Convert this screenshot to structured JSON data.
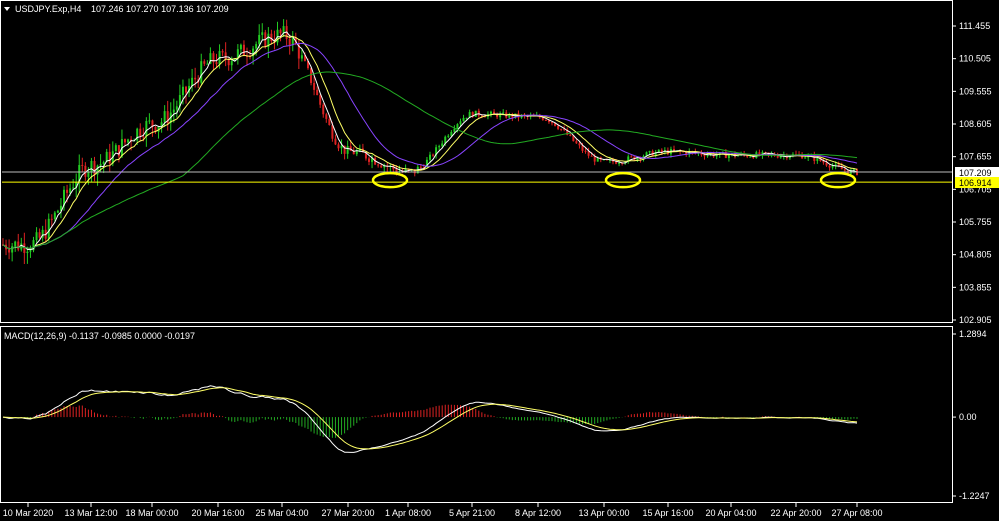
{
  "colors": {
    "background": "#000000",
    "grid": "#ffffff",
    "bull_candle": "#22cc22",
    "bear_candle": "#dd2222",
    "ma_fast": "#ffffff",
    "ma_mid": "#ffff66",
    "ma_slow": "#8844ff",
    "ma_long": "#22aa22",
    "level_line": "#ffff00",
    "highlight_circle": "#ffff00",
    "macd_line": "#ffffff",
    "signal_line": "#ffff66",
    "hist_pos": "#dd2222",
    "hist_neg": "#22aa22",
    "price_tag_current": "#ffffff",
    "price_tag_level": "#ffff00"
  },
  "header": {
    "symbol": "USDJPY.Exp,H4",
    "ohlc": "107.246 107.270 107.136 107.209"
  },
  "macd_header": {
    "label": "MACD(12,26,9) -0.1137 -0.0985 0.0000 -0.0197"
  },
  "price_axis": {
    "ticks": [
      "111.455",
      "110.505",
      "109.555",
      "108.605",
      "107.655",
      "106.705",
      "105.755",
      "104.805",
      "103.855",
      "102.905"
    ],
    "current_price_tag": "107.209",
    "level_price_tag": "106.914"
  },
  "macd_axis": {
    "ticks": [
      "1.2894",
      "0.00",
      "-1.2247"
    ]
  },
  "time_axis": {
    "ticks": [
      "10 Mar 2020",
      "13 Mar 12:00",
      "18 Mar 00:00",
      "20 Mar 16:00",
      "25 Mar 04:00",
      "27 Mar 20:00",
      "1 Apr 08:00",
      "5 Apr 21:00",
      "8 Apr 12:00",
      "13 Apr 00:00",
      "15 Apr 16:00",
      "20 Apr 04:00",
      "22 Apr 20:00",
      "27 Apr 08:00"
    ]
  },
  "chart_data": {
    "type": "line",
    "symbol": "USDJPY",
    "timeframe": "H4",
    "ylim": [
      102.905,
      111.455
    ],
    "x_tick_labels": [
      "10 Mar 2020",
      "13 Mar 12:00",
      "18 Mar 00:00",
      "20 Mar 16:00",
      "25 Mar 04:00",
      "27 Mar 20:00",
      "1 Apr 08:00",
      "5 Apr 21:00",
      "8 Apr 12:00",
      "13 Apr 00:00",
      "15 Apr 16:00",
      "20 Apr 04:00",
      "22 Apr 20:00",
      "27 Apr 08:00"
    ],
    "close_path": [
      {
        "x": "10 Mar 2020",
        "y": 105.1
      },
      {
        "x": "13 Mar 12:00",
        "y": 107.4
      },
      {
        "x": "18 Mar 00:00",
        "y": 108.6
      },
      {
        "x": "20 Mar 16:00",
        "y": 110.5
      },
      {
        "x": "25 Mar 04:00",
        "y": 111.2
      },
      {
        "x": "27 Mar 20:00",
        "y": 107.8
      },
      {
        "x": "1 Apr 08:00",
        "y": 107.2
      },
      {
        "x": "5 Apr 21:00",
        "y": 108.9
      },
      {
        "x": "8 Apr 12:00",
        "y": 108.8
      },
      {
        "x": "13 Apr 00:00",
        "y": 107.5
      },
      {
        "x": "15 Apr 16:00",
        "y": 107.8
      },
      {
        "x": "20 Apr 04:00",
        "y": 107.7
      },
      {
        "x": "22 Apr 20:00",
        "y": 107.7
      },
      {
        "x": "27 Apr 08:00",
        "y": 107.2
      }
    ],
    "horizontal_levels": [
      107.209,
      106.914
    ],
    "highlighted_lows": [
      "1 Apr 08:00",
      "13 Apr 00:00",
      "27 Apr 08:00"
    ],
    "macd": {
      "params": "12,26,9",
      "values": [
        -0.1137,
        -0.0985,
        0.0,
        -0.0197
      ],
      "ylim": [
        -1.2247,
        1.2894
      ]
    }
  }
}
